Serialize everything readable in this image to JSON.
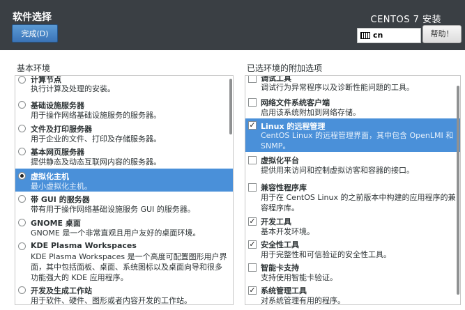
{
  "header": {
    "title": "软件选择",
    "done_label": "完成(D)",
    "product": "CENTOS 7 安装",
    "keyboard": "cn",
    "help_label": "帮助！"
  },
  "left": {
    "heading": "基本环境",
    "items": [
      {
        "name": "计算节点",
        "desc": "执行计算及处理的安装。",
        "selected": false
      },
      {
        "name": "基础设施服务器",
        "desc": "用于操作网络基础设施服务的服务器。",
        "selected": false
      },
      {
        "name": "文件及打印服务器",
        "desc": "用于企业的文件、打印及存储服务器。",
        "selected": false
      },
      {
        "name": "基本网页服务器",
        "desc": "提供静态及动态互联网内容的服务器。",
        "selected": false
      },
      {
        "name": "虚拟化主机",
        "desc": "最小虚拟化主机。",
        "selected": true
      },
      {
        "name": "带 GUI 的服务器",
        "desc": "带有用于操作网络基础设施服务 GUI 的服务器。",
        "selected": false
      },
      {
        "name": "GNOME 桌面",
        "desc": "GNOME 是一个非常直观且用户友好的桌面环境。",
        "selected": false
      },
      {
        "name": "KDE Plasma Workspaces",
        "desc": "KDE Plasma Workspaces 是一个高度可配置图形用户界面，其中包括面板、桌面、系统图标以及桌面向导和很多功能强大的 KDE 应用程序。",
        "selected": false
      },
      {
        "name": "开发及生成工作站",
        "desc": "用于软件、硬件、图形或者内容开发的工作站。",
        "selected": false
      }
    ]
  },
  "right": {
    "heading": "已选环境的附加选项",
    "items": [
      {
        "name": "调试工具",
        "desc": "调试行为异常程序以及诊断性能问题的工具。",
        "checked": false
      },
      {
        "name": "网络文件系统客户端",
        "desc": "启用该系统附加到网络存储。",
        "checked": false
      },
      {
        "name": "Linux 的远程管理",
        "desc": "CentOS Linux 的远程管理界面，其中包含 OpenLMI 和 SNMP。",
        "checked": true,
        "selected": true
      },
      {
        "name": "虚拟化平台",
        "desc": "提供用来访问和控制虚拟访客和容器的接口。",
        "checked": false
      },
      {
        "name": "兼容性程序库",
        "desc": "用于在 CentOS Linux 的之前版本中构建的应用程序的兼容程序库。",
        "checked": false
      },
      {
        "name": "开发工具",
        "desc": "基本开发环境。",
        "checked": true
      },
      {
        "name": "安全性工具",
        "desc": "用于完整性和可信验证的安全性工具。",
        "checked": true
      },
      {
        "name": "智能卡支持",
        "desc": "支持使用智能卡验证。",
        "checked": false
      },
      {
        "name": "系统管理工具",
        "desc": "对系统管理有用的程序。",
        "checked": true
      }
    ]
  }
}
